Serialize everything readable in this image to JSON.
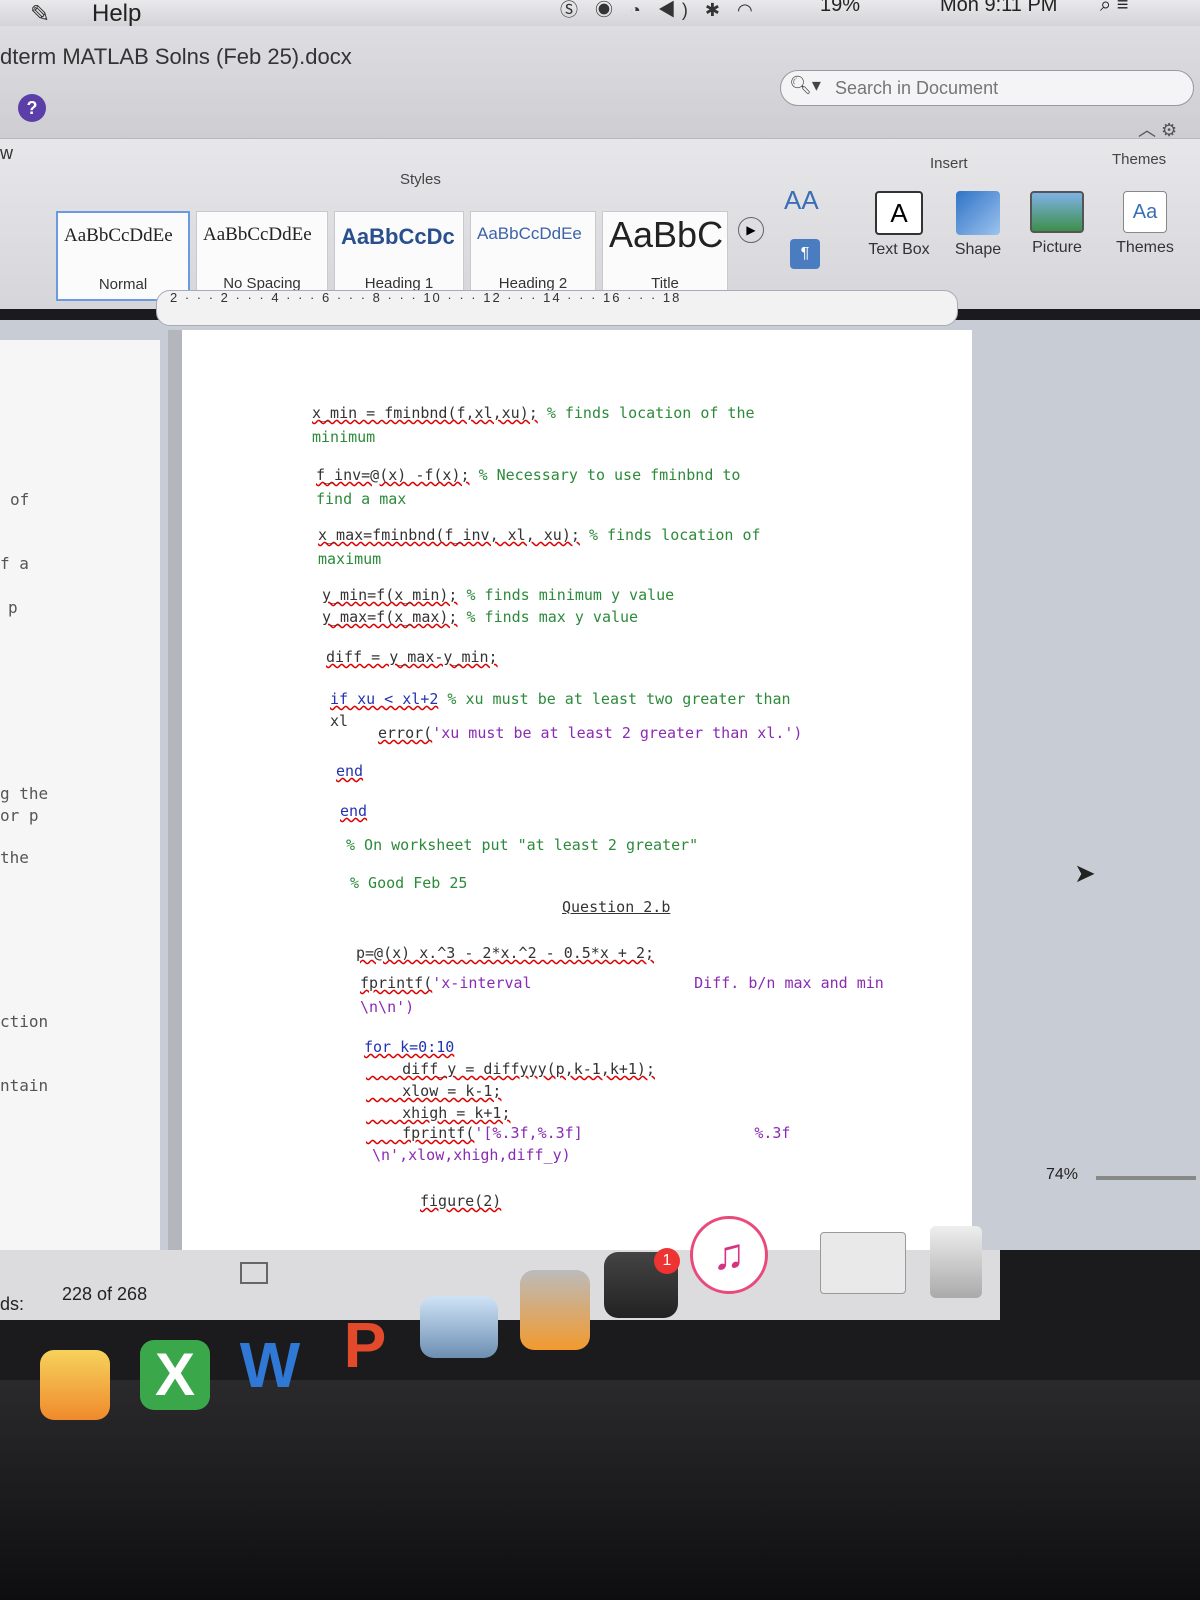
{
  "menubar": {
    "help": "Help",
    "battery": "19%",
    "clock": "Mon 9:11 PM"
  },
  "window": {
    "title": "dterm MATLAB Solns (Feb 25).docx",
    "search_placeholder": "Search in Document"
  },
  "ribbon": {
    "tab_partial": "w",
    "styles_label": "Styles",
    "insert_label": "Insert",
    "themes_label": "Themes",
    "styles": [
      {
        "sample": "AaBbCcDdEe",
        "caption": "Normal"
      },
      {
        "sample": "AaBbCcDdEe",
        "caption": "No Spacing"
      },
      {
        "sample": "AaBbCcDc",
        "caption": "Heading 1"
      },
      {
        "sample": "AaBbCcDdEe",
        "caption": "Heading 2"
      },
      {
        "sample": "AaBbC",
        "caption": "Title"
      }
    ],
    "tools": [
      {
        "label": "Text Box",
        "icon": "text-box-icon"
      },
      {
        "label": "Shape",
        "icon": "shape-icon"
      },
      {
        "label": "Picture",
        "icon": "picture-icon"
      },
      {
        "label": "Themes",
        "icon": "themes-icon"
      }
    ]
  },
  "ruler": {
    "numbers": "2 · · · 2 · · · 4 · · · 6 · · · 8 · · · 10 · · · 12 · · · 14 · · · 16 · · · 18"
  },
  "left_page": [
    "of",
    "f a",
    "p",
    "g the",
    "or p",
    "the",
    "ction",
    "ntain"
  ],
  "code_lines": [
    {
      "text": "x_min = fminbnd(f,xl,xu);",
      "comment": "% finds location of the"
    },
    {
      "text": "minimum",
      "comment": ""
    },
    {
      "text": "f_inv=@(x) -f(x);",
      "comment": "% Necessary to use fminbnd to"
    },
    {
      "text": "find a max",
      "comment": ""
    },
    {
      "text": "x_max=fminbnd(f_inv, xl, xu);",
      "comment": "% finds location of"
    },
    {
      "text": "maximum",
      "comment": ""
    },
    {
      "text": "y_min=f(x_min);",
      "comment": "% finds minimum y value"
    },
    {
      "text": "y_max=f(x_max);",
      "comment": "% finds max y value"
    },
    {
      "text": "diff = y_max-y_min;",
      "comment": ""
    },
    {
      "text": "if xu < xl+2",
      "comment": "% xu must be at least two greater than"
    },
    {
      "text": "xl",
      "comment": ""
    },
    {
      "text": "error(",
      "comment": "'xu must be at least 2 greater than xl.')"
    },
    {
      "text": "end",
      "comment": ""
    },
    {
      "text": "end",
      "comment": ""
    },
    {
      "text": "",
      "comment": "% On worksheet put \"at least 2 greater\""
    },
    {
      "text": "",
      "comment": "% Good Feb 25"
    },
    {
      "text": "Question 2.b",
      "comment": ""
    },
    {
      "text": "p=@(x) x.^3 - 2*x.^2 - 0.5*x + 2;",
      "comment": ""
    },
    {
      "text": "fprintf(",
      "comment": "'x-interval                  Diff. b/n max and min"
    },
    {
      "text": "\\n\\n')",
      "comment": ""
    },
    {
      "text": "for k=0:10",
      "comment": ""
    },
    {
      "text": "    diff_y = diffyyy(p,k-1,k+1);",
      "comment": ""
    },
    {
      "text": "    xlow = k-1;",
      "comment": ""
    },
    {
      "text": "    xhigh = k+1;",
      "comment": ""
    },
    {
      "text": "    fprintf(",
      "comment": "'[%.3f,%.3f]                   %.3f"
    },
    {
      "text": "\\n',xlow,xhigh,diff_y)",
      "comment": ""
    },
    {
      "text": "figure(2)",
      "comment": ""
    }
  ],
  "status": {
    "words_label": "ds:",
    "page_count": "228 of 268",
    "zoom": "74%"
  },
  "dock": {
    "badge": "1"
  }
}
